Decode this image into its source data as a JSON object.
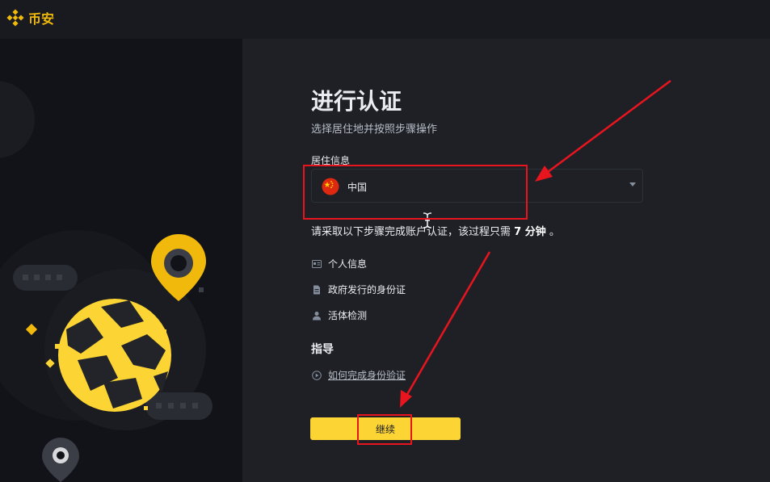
{
  "app": {
    "name": "币安"
  },
  "form": {
    "title": "进行认证",
    "subtitle": "选择居住地并按照步骤操作",
    "residence_label": "居住信息",
    "country": {
      "selected": "中国"
    },
    "notice": {
      "prefix": "请采取以下步骤完成账户认证，该过程只需",
      "time": "7 分钟",
      "suffix": "。"
    },
    "steps": [
      {
        "label": "个人信息",
        "icon": "id-card-icon"
      },
      {
        "label": "政府发行的身份证",
        "icon": "document-icon"
      },
      {
        "label": "活体检测",
        "icon": "user-icon"
      }
    ],
    "guide": {
      "title": "指导",
      "link_label": "如何完成身份验证",
      "icon": "play-circle-icon"
    },
    "continue_label": "继续"
  },
  "colors": {
    "brand": "#f0b90b",
    "button": "#fcd535",
    "annotation": "#e8141e",
    "background": "#1e2026"
  }
}
